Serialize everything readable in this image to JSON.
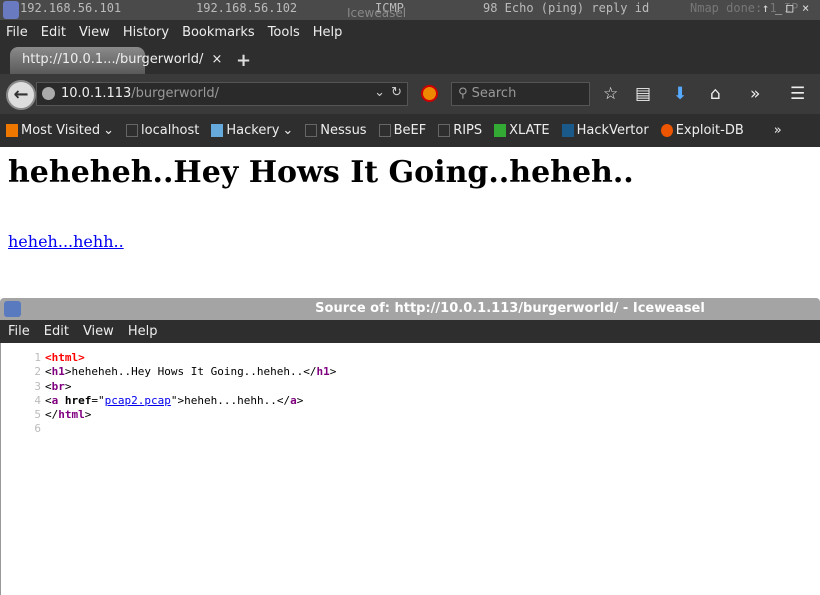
{
  "background": {
    "cols": [
      "192.168.56.101",
      "192.168.56.102",
      "ICMP",
      "98 Echo (ping) reply   id",
      "Iceweasel",
      "Nmap done: 1 IP"
    ],
    "window_controls": [
      "↑",
      "_",
      "□",
      "×"
    ]
  },
  "menu": [
    "File",
    "Edit",
    "View",
    "History",
    "Bookmarks",
    "Tools",
    "Help"
  ],
  "tab": {
    "title": "http://10.0.1.../burgerworld/",
    "close": "×",
    "new": "+"
  },
  "nav": {
    "url_host": "10.0.1.113",
    "url_path": "/burgerworld/",
    "search_placeholder": "Search"
  },
  "bookmarks": [
    "Most Visited",
    "localhost",
    "Hackery",
    "Nessus",
    "BeEF",
    "RIPS",
    "XLATE",
    "HackVertor",
    "Exploit-DB"
  ],
  "page": {
    "heading": "heheheh..Hey Hows It Going..heheh..",
    "link": "heheh...hehh.."
  },
  "source": {
    "title": "Source of: http://10.0.1.113/burgerworld/ - Iceweasel",
    "menu": [
      "File",
      "Edit",
      "View",
      "Help"
    ],
    "lines": {
      "l1": "html",
      "l2_text": "heheheh..Hey Hows It Going..heheh..",
      "l3": "br",
      "l4_attr": "href",
      "l4_val": "pcap2.pcap",
      "l4_text": "heheh...hehh..",
      "l5": "html"
    }
  }
}
